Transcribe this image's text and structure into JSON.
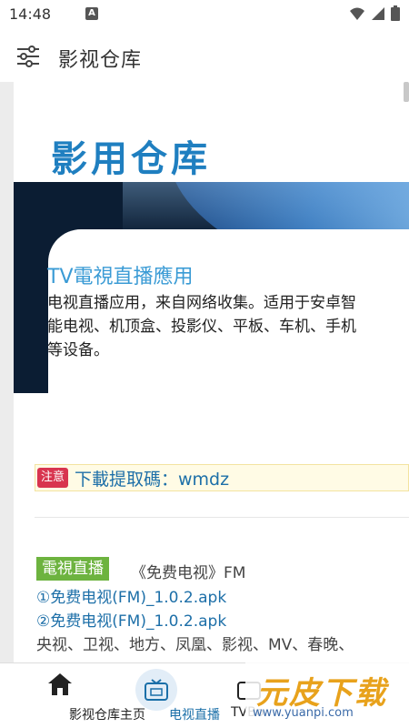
{
  "status_bar": {
    "time": "14:48",
    "badge": "A",
    "icons": [
      "wifi-icon",
      "signal-icon",
      "battery-icon"
    ]
  },
  "app_bar": {
    "title": "影视仓库",
    "menu_icon": "sliders-icon"
  },
  "content": {
    "brand": "影用仓库",
    "card": {
      "title": "TV電視直播應用",
      "description": "电视直播应用，来自网络收集。适用于安卓智能电视、机顶盒、投影仪、平板、车机、手机等设备。"
    },
    "notice": {
      "badge": "注意",
      "text": "下載提取碼：wmdz"
    },
    "section": {
      "tag": "電視直播",
      "subtitle": "《免费电视》FM",
      "links": [
        "①免费电视(FM)_1.0.2.apk",
        "②免费电视(FM)_1.0.2.apk"
      ],
      "channels": "央视、卫视、地方、凤凰、影视、MV、春晚、"
    }
  },
  "bottom_nav": {
    "items": [
      {
        "label": "影视仓库主页",
        "icon": "home-icon",
        "active": false
      },
      {
        "label": "电视直播",
        "icon": "tv-icon",
        "active": true
      },
      {
        "label": "TVBo",
        "icon": "tv-icon",
        "active": false
      }
    ]
  },
  "watermark": {
    "main": "元皮下载",
    "url": "www.yuanpi.com"
  },
  "colors": {
    "brand_blue": "#1f7fc0",
    "link_blue": "#1d6fa8",
    "active_nav": "#1a6fa8",
    "tag_green": "#6db33f",
    "badge_red": "#d8344f"
  }
}
